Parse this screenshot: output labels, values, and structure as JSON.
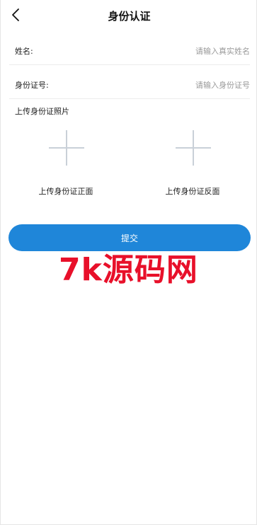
{
  "header": {
    "title": "身份认证",
    "back_icon": "chevron-left-icon"
  },
  "form": {
    "name": {
      "label": "姓名:",
      "placeholder": "请输入真实姓名",
      "value": ""
    },
    "id_number": {
      "label": "身份证号:",
      "placeholder": "请输入身份证号",
      "value": ""
    }
  },
  "photos": {
    "section_label": "上传身份证照片",
    "front_label": "上传身份证正面",
    "back_label": "上传身份证反面",
    "plus_icon": "plus-icon",
    "plus_color": "#c9d0d8"
  },
  "submit": {
    "label": "提交",
    "color": "#1f86d9"
  },
  "watermark": {
    "text": "7k源码网",
    "color": "#e8102a"
  }
}
